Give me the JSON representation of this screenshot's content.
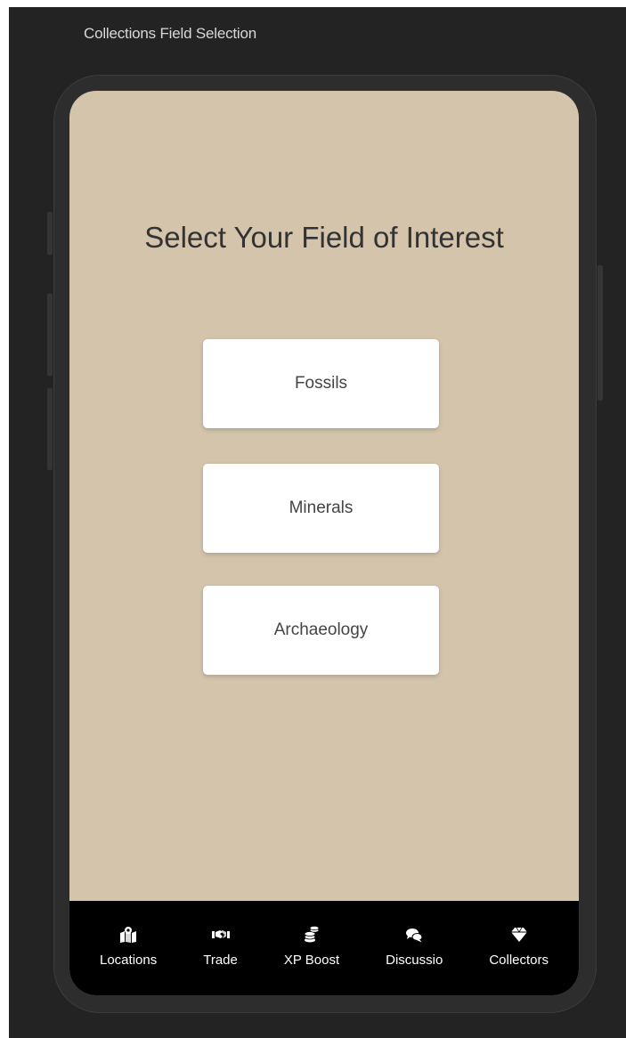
{
  "window": {
    "title": "Collections Field Selection"
  },
  "screen": {
    "heading": "Select Your Field of Interest",
    "background": "#d3c4ab"
  },
  "options": [
    {
      "label": "Fossils"
    },
    {
      "label": "Minerals"
    },
    {
      "label": "Archaeology"
    }
  ],
  "tabbar": {
    "background": "#000000",
    "tabs": [
      {
        "label": "Locations",
        "icon": "map-marker-icon"
      },
      {
        "label": "Trade",
        "icon": "handshake-icon"
      },
      {
        "label": "XP Boost",
        "icon": "coins-icon"
      },
      {
        "label": "Discussio",
        "icon": "comments-icon"
      },
      {
        "label": "Collectors",
        "icon": "gem-icon"
      }
    ]
  }
}
